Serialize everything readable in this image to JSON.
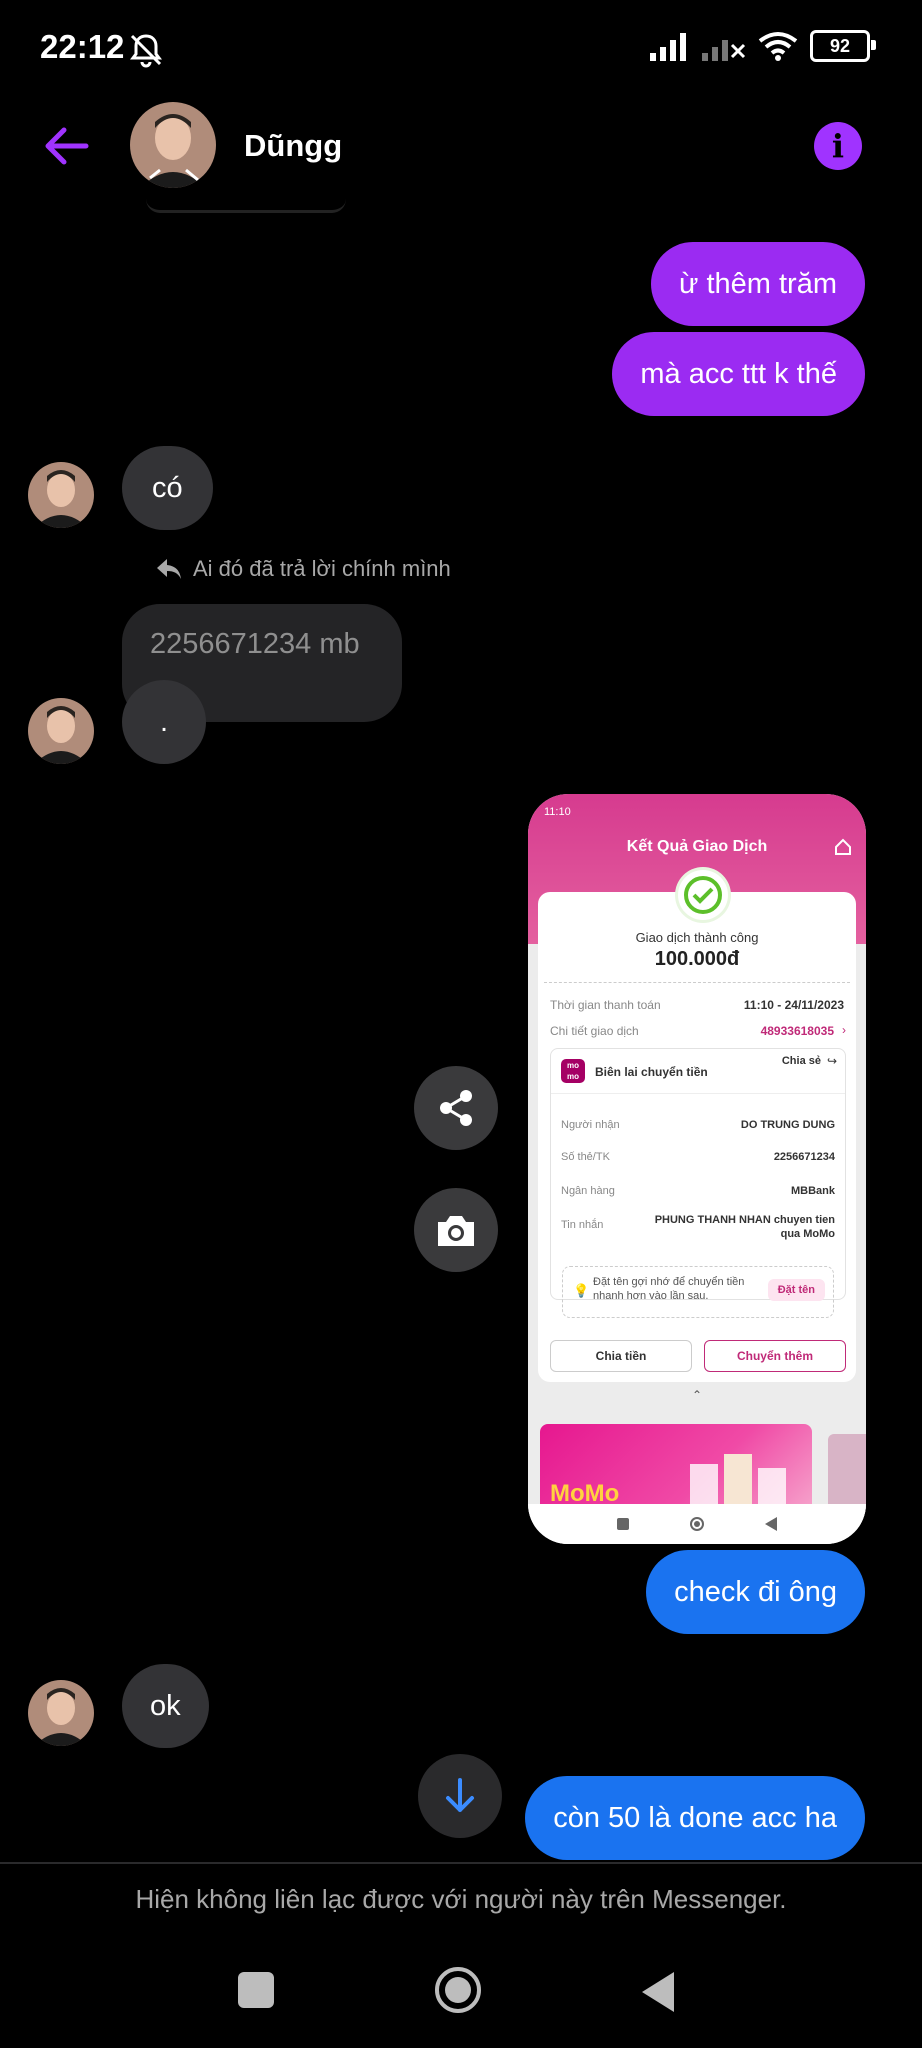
{
  "status_bar": {
    "time": "22:12",
    "battery": "92"
  },
  "header": {
    "contact_name": "Dũngg"
  },
  "messages": {
    "m1": "ừ thêm trăm",
    "m2": "mà acc ttt k thế",
    "m3": "có",
    "reply_note": "Ai đó đã trả lời chính mình",
    "reply_quote": "2256671234 mb",
    "m4": ".",
    "m5": "check đi ông",
    "m6": "ok",
    "m7": "còn 50 là done acc ha"
  },
  "screenshot": {
    "status_time": "11:10",
    "title": "Kết Quả Giao Dịch",
    "success": "Giao dịch thành công",
    "amount": "100.000đ",
    "time_label": "Thời gian thanh toán",
    "time_value": "11:10 - 24/11/2023",
    "detail_label": "Chi tiết giao dịch",
    "detail_value": "48933618035",
    "receipt_title": "Biên lai chuyển tiền",
    "share": "Chia sẻ",
    "recipient_label": "Người nhận",
    "recipient_value": "DO TRUNG DUNG",
    "account_label": "Số thẻ/TK",
    "account_value": "2256671234",
    "bank_label": "Ngân hàng",
    "bank_value": "MBBank",
    "message_label": "Tin nhắn",
    "message_value": "PHUNG THANH NHAN chuyen tien qua MoMo",
    "hint": "Đặt tên gợi nhớ để chuyển tiền nhanh hơn vào lần sau.",
    "name_button": "Đặt tên",
    "split_button": "Chia tiền",
    "transfer_more_button": "Chuyển thêm",
    "momo_logo": "mo mo",
    "banner_text": "MoMo"
  },
  "footer": {
    "notice": "Hiện không liên lạc được với người này trên Messenger."
  },
  "colors": {
    "accent": "#9b2bf2",
    "outgoing_blue": "#1a73f0",
    "incoming": "#333336"
  }
}
